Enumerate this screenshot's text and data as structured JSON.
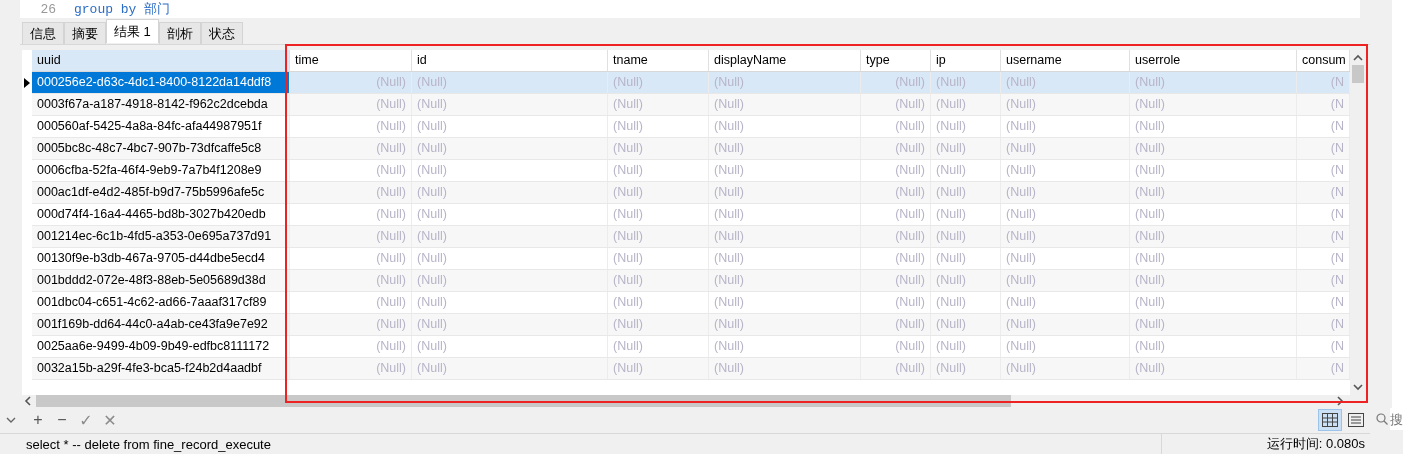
{
  "editor": {
    "line_number": "26",
    "code": "group by 部门"
  },
  "tabs": [
    {
      "label": "信息",
      "selected": false
    },
    {
      "label": "摘要",
      "selected": false
    },
    {
      "label": "结果 1",
      "selected": true
    },
    {
      "label": "剖析",
      "selected": false
    },
    {
      "label": "状态",
      "selected": false
    }
  ],
  "table": {
    "columns": [
      {
        "label": "uuid",
        "kind": "text"
      },
      {
        "label": "time",
        "kind": "number"
      },
      {
        "label": "id",
        "kind": "text"
      },
      {
        "label": "tname",
        "kind": "text"
      },
      {
        "label": "displayName",
        "kind": "text"
      },
      {
        "label": "type",
        "kind": "number"
      },
      {
        "label": "ip",
        "kind": "text"
      },
      {
        "label": "username",
        "kind": "text"
      },
      {
        "label": "userrole",
        "kind": "text"
      },
      {
        "label": "consum",
        "kind": "number"
      }
    ],
    "rows": [
      {
        "selected": true,
        "cells": [
          "000256e2-d63c-4dc1-8400-8122da14ddf8",
          "(Null)",
          "(Null)",
          "(Null)",
          "(Null)",
          "(Null)",
          "(Null)",
          "(Null)",
          "(Null)",
          "(N"
        ]
      },
      {
        "selected": false,
        "cells": [
          "0003f67a-a187-4918-8142-f962c2dcebda",
          "(Null)",
          "(Null)",
          "(Null)",
          "(Null)",
          "(Null)",
          "(Null)",
          "(Null)",
          "(Null)",
          "(N"
        ]
      },
      {
        "selected": false,
        "cells": [
          "000560af-5425-4a8a-84fc-afa44987951f",
          "(Null)",
          "(Null)",
          "(Null)",
          "(Null)",
          "(Null)",
          "(Null)",
          "(Null)",
          "(Null)",
          "(N"
        ]
      },
      {
        "selected": false,
        "cells": [
          "0005bc8c-48c7-4bc7-907b-73dfcaffe5c8",
          "(Null)",
          "(Null)",
          "(Null)",
          "(Null)",
          "(Null)",
          "(Null)",
          "(Null)",
          "(Null)",
          "(N"
        ]
      },
      {
        "selected": false,
        "cells": [
          "0006cfba-52fa-46f4-9eb9-7a7b4f1208e9",
          "(Null)",
          "(Null)",
          "(Null)",
          "(Null)",
          "(Null)",
          "(Null)",
          "(Null)",
          "(Null)",
          "(N"
        ]
      },
      {
        "selected": false,
        "cells": [
          "000ac1df-e4d2-485f-b9d7-75b5996afe5c",
          "(Null)",
          "(Null)",
          "(Null)",
          "(Null)",
          "(Null)",
          "(Null)",
          "(Null)",
          "(Null)",
          "(N"
        ]
      },
      {
        "selected": false,
        "cells": [
          "000d74f4-16a4-4465-bd8b-3027b420edb",
          "(Null)",
          "(Null)",
          "(Null)",
          "(Null)",
          "(Null)",
          "(Null)",
          "(Null)",
          "(Null)",
          "(N"
        ]
      },
      {
        "selected": false,
        "cells": [
          "001214ec-6c1b-4fd5-a353-0e695a737d91",
          "(Null)",
          "(Null)",
          "(Null)",
          "(Null)",
          "(Null)",
          "(Null)",
          "(Null)",
          "(Null)",
          "(N"
        ]
      },
      {
        "selected": false,
        "cells": [
          "00130f9e-b3db-467a-9705-d44dbe5ecd4",
          "(Null)",
          "(Null)",
          "(Null)",
          "(Null)",
          "(Null)",
          "(Null)",
          "(Null)",
          "(Null)",
          "(N"
        ]
      },
      {
        "selected": false,
        "cells": [
          "001bddd2-072e-48f3-88eb-5e05689d38d",
          "(Null)",
          "(Null)",
          "(Null)",
          "(Null)",
          "(Null)",
          "(Null)",
          "(Null)",
          "(Null)",
          "(N"
        ]
      },
      {
        "selected": false,
        "cells": [
          "001dbc04-c651-4c62-ad66-7aaaf317cf89",
          "(Null)",
          "(Null)",
          "(Null)",
          "(Null)",
          "(Null)",
          "(Null)",
          "(Null)",
          "(Null)",
          "(N"
        ]
      },
      {
        "selected": false,
        "cells": [
          "001f169b-dd64-44c0-a4ab-ce43fa9e7e92",
          "(Null)",
          "(Null)",
          "(Null)",
          "(Null)",
          "(Null)",
          "(Null)",
          "(Null)",
          "(Null)",
          "(N"
        ]
      },
      {
        "selected": false,
        "cells": [
          "0025aa6e-9499-4b09-9b49-edfbc8111172",
          "(Null)",
          "(Null)",
          "(Null)",
          "(Null)",
          "(Null)",
          "(Null)",
          "(Null)",
          "(Null)",
          "(N"
        ]
      },
      {
        "selected": false,
        "cells": [
          "0032a15b-a29f-4fe3-bca5-f24b2d4aadbf",
          "(Null)",
          "(Null)",
          "(Null)",
          "(Null)",
          "(Null)",
          "(Null)",
          "(Null)",
          "(Null)",
          "(N"
        ]
      }
    ]
  },
  "toolbar": {
    "buttons": [
      {
        "label": "+",
        "disabled": false
      },
      {
        "label": "−",
        "disabled": false
      },
      {
        "label": "✓",
        "disabled": true
      },
      {
        "label": "✕",
        "disabled": true
      }
    ],
    "views": [
      {
        "kind": "grid",
        "selected": true
      },
      {
        "kind": "form",
        "selected": false
      }
    ]
  },
  "search": {
    "placeholder": "搜"
  },
  "status_bar": {
    "query": "select *  -- delete  from fine_record_execute",
    "runtime": "运行时间: 0.080s"
  }
}
